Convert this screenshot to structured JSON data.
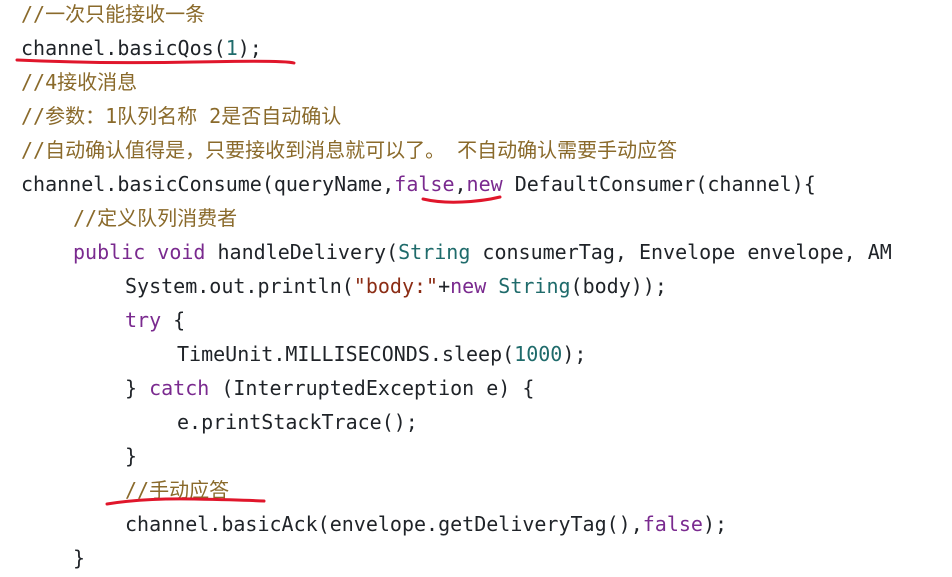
{
  "editor": {
    "lines": [
      {
        "indent": 0,
        "tokens": [
          {
            "t": "//一次只能接收一条",
            "k": "comment"
          }
        ]
      },
      {
        "indent": 0,
        "tokens": [
          {
            "t": "channel.basicQos(",
            "k": "plain"
          },
          {
            "t": "1",
            "k": "number"
          },
          {
            "t": ");",
            "k": "plain"
          }
        ]
      },
      {
        "indent": 0,
        "tokens": [
          {
            "t": "//4接收消息",
            "k": "comment"
          }
        ]
      },
      {
        "indent": 0,
        "tokens": [
          {
            "t": "//参数：1队列名称 2是否自动确认",
            "k": "comment"
          }
        ]
      },
      {
        "indent": 0,
        "tokens": [
          {
            "t": "//自动确认值得是，只要接收到消息就可以了。 不自动确认需要手动应答",
            "k": "comment"
          }
        ]
      },
      {
        "indent": 0,
        "tokens": [
          {
            "t": "channel.basicConsume(queryName,",
            "k": "plain"
          },
          {
            "t": "false",
            "k": "literal"
          },
          {
            "t": ",",
            "k": "plain"
          },
          {
            "t": "new",
            "k": "keyword"
          },
          {
            "t": " DefaultConsumer(channel){",
            "k": "plain"
          }
        ]
      },
      {
        "indent": 1,
        "tokens": [
          {
            "t": "//定义队列消费者",
            "k": "comment"
          }
        ]
      },
      {
        "indent": 1,
        "tokens": [
          {
            "t": "public",
            "k": "keyword"
          },
          {
            "t": " ",
            "k": "plain"
          },
          {
            "t": "void",
            "k": "keyword"
          },
          {
            "t": " handleDelivery(",
            "k": "plain"
          },
          {
            "t": "String",
            "k": "type"
          },
          {
            "t": " consumerTag, Envelope envelope, AM",
            "k": "plain"
          }
        ]
      },
      {
        "indent": 2,
        "tokens": [
          {
            "t": "System.out.println(",
            "k": "plain"
          },
          {
            "t": "\"body:\"",
            "k": "string"
          },
          {
            "t": "+",
            "k": "plain"
          },
          {
            "t": "new",
            "k": "keyword"
          },
          {
            "t": " ",
            "k": "plain"
          },
          {
            "t": "String",
            "k": "type"
          },
          {
            "t": "(body));",
            "k": "plain"
          }
        ]
      },
      {
        "indent": 2,
        "tokens": [
          {
            "t": "try",
            "k": "keyword"
          },
          {
            "t": " {",
            "k": "plain"
          }
        ]
      },
      {
        "indent": 3,
        "tokens": [
          {
            "t": "TimeUnit.MILLISECONDS.sleep(",
            "k": "plain"
          },
          {
            "t": "1000",
            "k": "number"
          },
          {
            "t": ");",
            "k": "plain"
          }
        ]
      },
      {
        "indent": 2,
        "tokens": [
          {
            "t": "} ",
            "k": "plain"
          },
          {
            "t": "catch",
            "k": "keyword"
          },
          {
            "t": " (InterruptedException e) {",
            "k": "plain"
          }
        ]
      },
      {
        "indent": 3,
        "tokens": [
          {
            "t": "e.printStackTrace();",
            "k": "plain"
          }
        ]
      },
      {
        "indent": 2,
        "tokens": [
          {
            "t": "}",
            "k": "plain"
          }
        ]
      },
      {
        "indent": 2,
        "tokens": [
          {
            "t": "//手动应答",
            "k": "comment"
          }
        ]
      },
      {
        "indent": 2,
        "tokens": [
          {
            "t": "channel.basicAck(envelope.getDeliveryTag(),",
            "k": "plain"
          },
          {
            "t": "false",
            "k": "literal"
          },
          {
            "t": ");",
            "k": "plain"
          }
        ]
      },
      {
        "indent": 1,
        "tokens": [
          {
            "t": "}",
            "k": "plain"
          }
        ]
      }
    ]
  },
  "annotations": {
    "color": "#e0162b",
    "marks": [
      {
        "target": "line-2-underline"
      },
      {
        "target": "false-literal-underline"
      },
      {
        "target": "manual-ack-comment-underline"
      }
    ]
  }
}
